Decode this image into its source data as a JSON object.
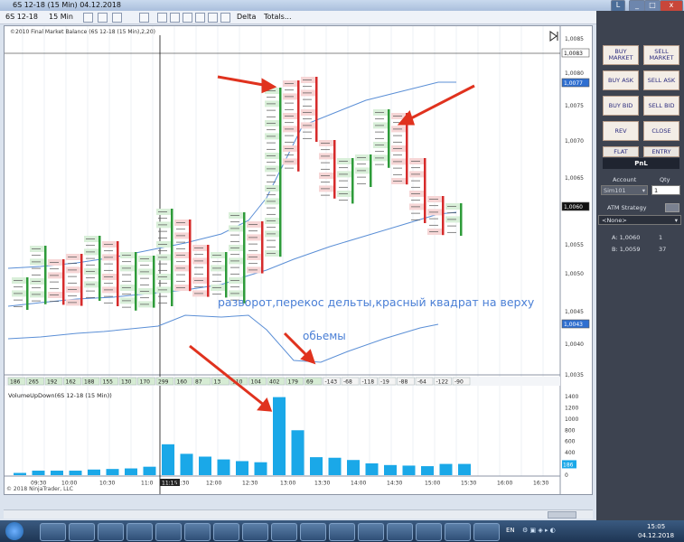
{
  "window": {
    "title": "6S 12-18 (15 Min)  04.12.2018",
    "controls": {
      "minimize": "_",
      "maximize": "□",
      "close": "x"
    },
    "right_buttons": [
      "L"
    ]
  },
  "toolbar": {
    "instrument": "6S 12-18",
    "interval": "15 Min",
    "delta": "Delta",
    "totals": "Totals..."
  },
  "chart": {
    "header": "©2010 Final Market Balance  (6S 12-18 (15 Min),2,20)",
    "annotation_main": "разворот,перекос дельты,красный квадрат на верху",
    "annotation_volume": "обьемы",
    "volume_header": "VolumeUpDown(6S 12-18 (15 Min))",
    "copyright": "© 2018 NinjaTrader, LLC",
    "price_axis": [
      "1,0085",
      "1,0083",
      "1,0080",
      "1,0077",
      "1,0075",
      "1,0070",
      "1,0065",
      "1,0060",
      "1,0055",
      "1,0050",
      "1,0045",
      "1,0043",
      "1,0040",
      "1,0035"
    ],
    "volume_axis": [
      "1400",
      "1200",
      "1000",
      "800",
      "600",
      "400",
      "200",
      "186",
      "0"
    ],
    "time_axis": [
      "09:30",
      "10:00",
      "10:30",
      "11:0",
      "11:15",
      "11:30",
      "12:00",
      "12:30",
      "13:00",
      "13:30",
      "14:00",
      "14:30",
      "15:00",
      "15:30",
      "16:00",
      "16:30"
    ],
    "delta_row": [
      "186",
      "265",
      "192",
      "162",
      "188",
      "155",
      "130",
      "170",
      "299",
      "160",
      "87",
      "13",
      "110",
      "104",
      "402",
      "179",
      "69",
      "-143",
      "-68",
      "-118",
      "-19",
      "-88",
      "-64",
      "-122",
      "-90"
    ],
    "colors": {
      "up": "#2e9b3a",
      "down": "#d62b2b",
      "volume": "#1aa8e8",
      "bands": "#5b8fd6",
      "arrow": "#e0321e"
    }
  },
  "chart_data": {
    "type": "bar",
    "title": "VolumeUpDown(6S 12-18 (15 Min))",
    "categories": [
      "09:30",
      "09:45",
      "10:00",
      "10:15",
      "10:30",
      "10:45",
      "11:00",
      "11:15",
      "11:30",
      "11:45",
      "12:00",
      "12:15",
      "12:30",
      "12:45",
      "13:00",
      "13:15",
      "13:30",
      "13:45",
      "14:00",
      "14:15",
      "14:30",
      "14:45",
      "15:00",
      "15:15",
      "15:30"
    ],
    "values": [
      40,
      80,
      80,
      80,
      100,
      110,
      120,
      150,
      550,
      380,
      330,
      280,
      250,
      230,
      1390,
      800,
      320,
      310,
      270,
      210,
      180,
      170,
      160,
      200,
      200
    ],
    "ylim": [
      0,
      1400
    ]
  },
  "panel": {
    "buy_market": "BUY MARKET",
    "sell_market": "SELL MARKET",
    "buy_ask": "BUY ASK",
    "sell_ask": "SELL ASK",
    "buy_bid": "BUY BID",
    "sell_bid": "SELL BID",
    "rev": "REV",
    "close": "CLOSE",
    "flat": "FLAT",
    "entry": "ENTRY",
    "pnl": "PnL",
    "account_label": "Account",
    "qty_label": "Qty",
    "account_value": "Sim101",
    "qty_value": "1",
    "atm_label": "ATM Strategy",
    "atm_value": "<None>",
    "a_label": "A: 1,0060",
    "a_qty": "1",
    "b_label": "B: 1,0059",
    "b_qty": "37"
  },
  "taskbar": {
    "lang": "EN",
    "time": "15:05",
    "date": "04.12.2018"
  }
}
